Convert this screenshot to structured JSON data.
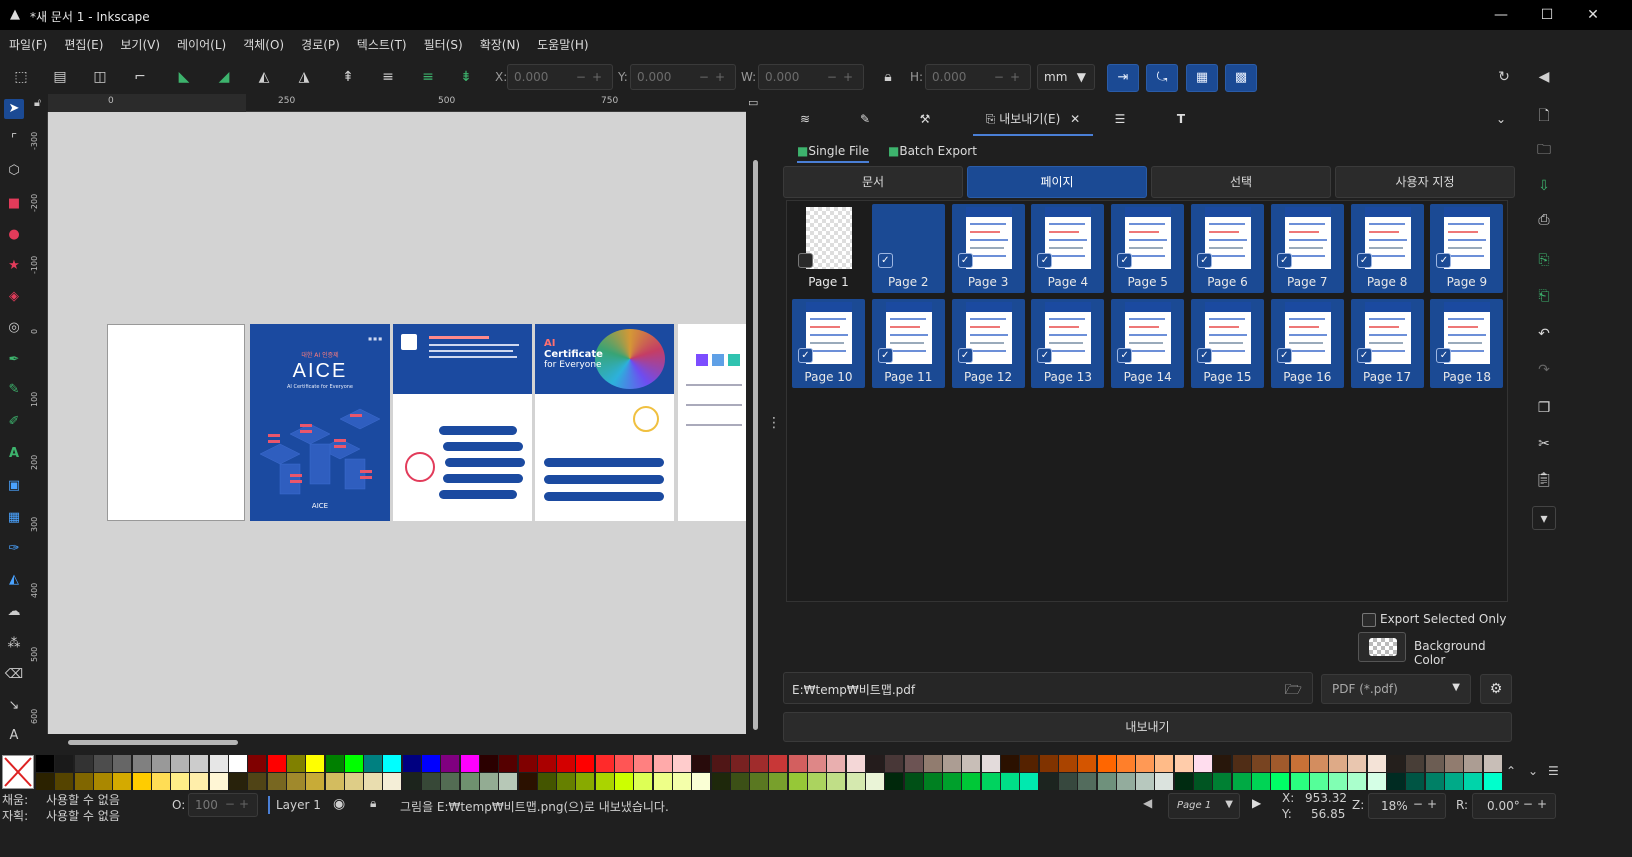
{
  "window": {
    "title": "*새 문서 1 - Inkscape",
    "controls": [
      "—",
      "☐",
      "✕"
    ]
  },
  "menu": [
    "파일(F)",
    "편집(E)",
    "보기(V)",
    "레이어(L)",
    "객체(O)",
    "경로(P)",
    "텍스트(T)",
    "필터(S)",
    "확장(N)",
    "도움말(H)"
  ],
  "toolbar": {
    "x_label": "X:",
    "x_value": "0.000",
    "y_label": "Y:",
    "y_value": "0.000",
    "w_label": "W:",
    "w_value": "0.000",
    "h_label": "H:",
    "h_value": "0.000",
    "unit": "mm"
  },
  "ruler": {
    "h_ticks": [
      "0",
      "250",
      "500",
      "750"
    ],
    "v_ticks": [
      "-300",
      "-200",
      "-100",
      "0",
      "100",
      "200",
      "300",
      "400",
      "500",
      "600"
    ]
  },
  "canvas_pages": [
    {
      "name": "blank"
    },
    {
      "name": "aice-cover",
      "headline": "AICE",
      "sub": "AI Certificate for Everyone",
      "tag": "대한 AI 인증제",
      "logo": "AICE"
    },
    {
      "name": "aice-intro"
    },
    {
      "name": "ai-certificate",
      "line1": "AI",
      "line2": "Certificate",
      "line3": "for Everyone"
    },
    {
      "name": "partial"
    }
  ],
  "export_panel": {
    "tabs": [
      "",
      "",
      "",
      "내보내기(E)",
      "",
      "T"
    ],
    "active_tab": "내보내기(E)",
    "subtabs": [
      "Single File",
      "Batch Export"
    ],
    "modes": [
      "문서",
      "페이지",
      "선택",
      "사용자 지정"
    ],
    "active_mode": "페이지",
    "pages": [
      {
        "label": "Page 1",
        "selected": false
      },
      {
        "label": "Page 2",
        "selected": true
      },
      {
        "label": "Page 3",
        "selected": true
      },
      {
        "label": "Page 4",
        "selected": true
      },
      {
        "label": "Page 5",
        "selected": true
      },
      {
        "label": "Page 6",
        "selected": true
      },
      {
        "label": "Page 7",
        "selected": true
      },
      {
        "label": "Page 8",
        "selected": true
      },
      {
        "label": "Page 9",
        "selected": true
      },
      {
        "label": "Page 10",
        "selected": true
      },
      {
        "label": "Page 11",
        "selected": true
      },
      {
        "label": "Page 12",
        "selected": true
      },
      {
        "label": "Page 13",
        "selected": true
      },
      {
        "label": "Page 14",
        "selected": true
      },
      {
        "label": "Page 15",
        "selected": true
      },
      {
        "label": "Page 16",
        "selected": true
      },
      {
        "label": "Page 17",
        "selected": true
      },
      {
        "label": "Page 18",
        "selected": true
      }
    ],
    "export_selected_only": "Export Selected Only",
    "background_color": "Background Color",
    "filename": "E:₩temp₩비트맵.pdf",
    "format": "PDF (*.pdf)",
    "export_button": "내보내기"
  },
  "status": {
    "fill_label": "채움:",
    "fill_value": "사용할 수 없음",
    "stroke_label": "자획:",
    "stroke_value": "사용할 수 없음",
    "opacity_label": "O:",
    "opacity_value": "100",
    "layer": "Layer 1",
    "message": "그림을 E:₩temp₩비트맵.png(으)로 내보냈습니다.",
    "page": "Page 1",
    "x_label": "X:",
    "x_value": "953.32",
    "y_label": "Y:",
    "y_value": "56.85",
    "zoom_label": "Z:",
    "zoom_value": "18%",
    "rot_label": "R:",
    "rot_value": "0.00°"
  },
  "colors": {
    "accent": "#1b4a94",
    "bg": "#1f1f1f",
    "canvas": "#d3d3d3"
  }
}
